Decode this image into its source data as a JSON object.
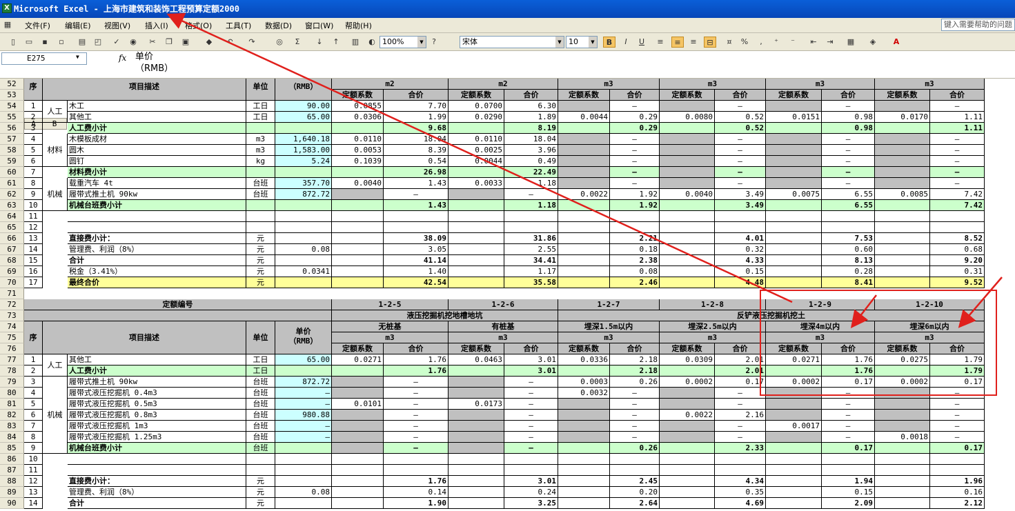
{
  "window": {
    "title": "Microsoft Excel - 上海市建筑和装饰工程预算定额2000"
  },
  "menu": [
    "文件(F)",
    "编辑(E)",
    "视图(V)",
    "插入(I)",
    "格式(O)",
    "工具(T)",
    "数据(D)",
    "窗口(W)",
    "帮助(H)"
  ],
  "help_box": "键入需要帮助的问题",
  "toolbar": {
    "zoom": "100%",
    "font": "宋体",
    "size": "10"
  },
  "formula": {
    "cell_ref": "E275",
    "fx": "fx",
    "content": "单价\n（RMB）"
  },
  "col_headers": [
    "A",
    "B"
  ],
  "table1": {
    "header_rows": [
      {
        "row": "52",
        "cells": [
          "序",
          "项目描述",
          "单位",
          "（RMB）",
          "m2",
          "",
          "m2",
          "",
          "m3",
          "",
          "m3",
          "",
          "m3",
          "",
          "m3",
          ""
        ]
      },
      {
        "row": "53",
        "cells": [
          "",
          "",
          "",
          "",
          "定额系数",
          "合价",
          "定额系数",
          "合价",
          "定额系数",
          "合价",
          "定额系数",
          "合价",
          "定额系数",
          "合价",
          "定额系数",
          "合价"
        ]
      }
    ],
    "rows": [
      {
        "row": "54",
        "cells": [
          "1",
          "人工",
          "木工",
          "工日",
          "90.00",
          "0.0855",
          "7.70",
          "0.0700",
          "6.30",
          "",
          "–",
          "",
          "–",
          "",
          "–",
          "",
          "–"
        ]
      },
      {
        "row": "55",
        "cells": [
          "2",
          "",
          "其他工",
          "工日",
          "65.00",
          "0.0306",
          "1.99",
          "0.0290",
          "1.89",
          "0.0044",
          "0.29",
          "0.0080",
          "0.52",
          "0.0151",
          "0.98",
          "0.0170",
          "1.11"
        ]
      },
      {
        "row": "56",
        "cells": [
          "3",
          "",
          "人工费小计",
          "",
          "",
          "",
          "9.68",
          "",
          "8.19",
          "",
          "0.29",
          "",
          "0.52",
          "",
          "0.98",
          "",
          "1.11"
        ]
      },
      {
        "row": "57",
        "cells": [
          "4",
          "材料",
          "木模板成材",
          "m3",
          "1,640.18",
          "0.0110",
          "18.04",
          "0.0110",
          "18.04",
          "",
          "–",
          "",
          "–",
          "",
          "–",
          "",
          "–"
        ]
      },
      {
        "row": "58",
        "cells": [
          "5",
          "",
          "圆木",
          "m3",
          "1,583.00",
          "0.0053",
          "8.39",
          "0.0025",
          "3.96",
          "",
          "–",
          "",
          "–",
          "",
          "–",
          "",
          "–"
        ]
      },
      {
        "row": "59",
        "cells": [
          "6",
          "",
          "圆钉",
          "kg",
          "5.24",
          "0.1039",
          "0.54",
          "0.0044",
          "0.49",
          "",
          "–",
          "",
          "–",
          "",
          "–",
          "",
          "–"
        ]
      },
      {
        "row": "60",
        "cells": [
          "7",
          "",
          "材料费小计",
          "",
          "",
          "",
          "26.98",
          "",
          "22.49",
          "",
          "–",
          "",
          "–",
          "",
          "–",
          "",
          "–"
        ]
      },
      {
        "row": "61",
        "cells": [
          "8",
          "机械",
          "载重汽车  4t",
          "台班",
          "357.70",
          "0.0040",
          "1.43",
          "0.0033",
          "1.18",
          "",
          "–",
          "",
          "–",
          "",
          "–",
          "",
          "–"
        ]
      },
      {
        "row": "62",
        "cells": [
          "9",
          "",
          "履带式推土机 90kw",
          "台班",
          "872.72",
          "",
          "–",
          "",
          "–",
          "0.0022",
          "1.92",
          "0.0040",
          "3.49",
          "0.0075",
          "6.55",
          "0.0085",
          "7.42"
        ]
      },
      {
        "row": "63",
        "cells": [
          "10",
          "",
          "机械台班费小计",
          "",
          "",
          "",
          "1.43",
          "",
          "1.18",
          "",
          "1.92",
          "",
          "3.49",
          "",
          "6.55",
          "",
          "7.42"
        ]
      },
      {
        "row": "64",
        "cells": [
          "11",
          "",
          "",
          "",
          "",
          "",
          "",
          "",
          "",
          "",
          "",
          "",
          "",
          "",
          "",
          "",
          ""
        ]
      },
      {
        "row": "65",
        "cells": [
          "12",
          "",
          "",
          "",
          "",
          "",
          "",
          "",
          "",
          "",
          "",
          "",
          "",
          "",
          "",
          "",
          ""
        ]
      },
      {
        "row": "66",
        "cells": [
          "13",
          "",
          "直接费小计：",
          "元",
          "",
          "",
          "38.09",
          "",
          "31.86",
          "",
          "2.21",
          "",
          "4.01",
          "",
          "7.53",
          "",
          "8.52"
        ]
      },
      {
        "row": "67",
        "cells": [
          "14",
          "",
          "管理费、利润（8%）",
          "元",
          "0.08",
          "",
          "3.05",
          "",
          "2.55",
          "",
          "0.18",
          "",
          "0.32",
          "",
          "0.60",
          "",
          "0.68"
        ]
      },
      {
        "row": "68",
        "cells": [
          "15",
          "",
          "合计",
          "元",
          "",
          "",
          "41.14",
          "",
          "34.41",
          "",
          "2.38",
          "",
          "4.33",
          "",
          "8.13",
          "",
          "9.20"
        ]
      },
      {
        "row": "69",
        "cells": [
          "16",
          "",
          "税金（3.41%）",
          "元",
          "0.0341",
          "",
          "1.40",
          "",
          "1.17",
          "",
          "0.08",
          "",
          "0.15",
          "",
          "0.28",
          "",
          "0.31"
        ]
      },
      {
        "row": "70",
        "cells": [
          "17",
          "",
          "最终合价",
          "元",
          "",
          "",
          "42.54",
          "",
          "35.58",
          "",
          "2.46",
          "",
          "4.48",
          "",
          "8.41",
          "",
          "9.52"
        ]
      }
    ]
  },
  "table2": {
    "header_rows": [
      {
        "row": "72",
        "cells": [
          "定额编号",
          "1-2-5",
          "1-2-6",
          "1-2-7",
          "1-2-8",
          "1-2-9",
          "1-2-10"
        ]
      },
      {
        "row": "73",
        "cells": [
          "液压挖掘机挖地槽地坑",
          "反铲液压挖掘机挖土"
        ]
      },
      {
        "row": "74",
        "cells": [
          "序",
          "项目描述",
          "单位",
          "单价",
          "无桩基",
          "有桩基",
          "埋深1.5m以内",
          "埋深2.5m以内",
          "埋深4m以内",
          "埋深6m以内"
        ]
      },
      {
        "row": "75",
        "cells": [
          "（RMB）",
          "m3",
          "m3",
          "m3",
          "m3",
          "m3",
          "m3"
        ]
      },
      {
        "row": "76",
        "cells": [
          "定额系数",
          "合价",
          "定额系数",
          "合价",
          "定额系数",
          "合价",
          "定额系数",
          "合价",
          "定额系数",
          "合价",
          "定额系数",
          "合价"
        ]
      }
    ],
    "rows": [
      {
        "row": "77",
        "cells": [
          "1",
          "人工",
          "其他工",
          "工日",
          "65.00",
          "0.0271",
          "1.76",
          "0.0463",
          "3.01",
          "0.0336",
          "2.18",
          "0.0309",
          "2.01",
          "0.0271",
          "1.76",
          "0.0275",
          "1.79"
        ]
      },
      {
        "row": "78",
        "cells": [
          "2",
          "",
          "人工费小计",
          "工日",
          "",
          "",
          "1.76",
          "",
          "3.01",
          "",
          "2.18",
          "",
          "2.01",
          "",
          "1.76",
          "",
          "1.79"
        ]
      },
      {
        "row": "79",
        "cells": [
          "3",
          "机械",
          "履带式推土机 90kw",
          "台班",
          "872.72",
          "",
          "–",
          "",
          "–",
          "0.0003",
          "0.26",
          "0.0002",
          "0.17",
          "0.0002",
          "0.17",
          "0.0002",
          "0.17"
        ]
      },
      {
        "row": "80",
        "cells": [
          "4",
          "",
          "履带式液压挖掘机 0.4m3",
          "台班",
          "–",
          "",
          "–",
          "",
          "–",
          "0.0032",
          "–",
          "",
          "–",
          "",
          "–",
          "",
          "–"
        ]
      },
      {
        "row": "81",
        "cells": [
          "5",
          "",
          "履带式液压挖掘机 0.5m3",
          "台班",
          "–",
          "0.0101",
          "–",
          "0.0173",
          "–",
          "",
          "–",
          "",
          "–",
          "",
          "–",
          "",
          "–"
        ]
      },
      {
        "row": "82",
        "cells": [
          "6",
          "",
          "履带式液压挖掘机 0.8m3",
          "台班",
          "980.88",
          "",
          "–",
          "",
          "–",
          "",
          "–",
          "0.0022",
          "2.16",
          "",
          "–",
          "",
          "–"
        ]
      },
      {
        "row": "83",
        "cells": [
          "7",
          "",
          "履带式液压挖掘机 1m3",
          "台班",
          "–",
          "",
          "–",
          "",
          "–",
          "",
          "–",
          "",
          "–",
          "0.0017",
          "–",
          "",
          "–"
        ]
      },
      {
        "row": "84",
        "cells": [
          "8",
          "",
          "履带式液压挖掘机 1.25m3",
          "台班",
          "–",
          "",
          "–",
          "",
          "–",
          "",
          "–",
          "",
          "–",
          "",
          "–",
          "0.0018",
          "–"
        ]
      },
      {
        "row": "85",
        "cells": [
          "9",
          "",
          "机械台班费小计",
          "台班",
          "",
          "",
          "–",
          "",
          "–",
          "",
          "0.26",
          "",
          "2.33",
          "",
          "0.17",
          "",
          "0.17"
        ]
      },
      {
        "row": "86",
        "cells": [
          "10",
          "",
          "",
          "",
          "",
          "",
          "",
          "",
          "",
          "",
          "",
          "",
          "",
          "",
          "",
          "",
          ""
        ]
      },
      {
        "row": "87",
        "cells": [
          "11",
          "",
          "",
          "",
          "",
          "",
          "",
          "",
          "",
          "",
          "",
          "",
          "",
          "",
          "",
          "",
          ""
        ]
      },
      {
        "row": "88",
        "cells": [
          "12",
          "",
          "直接费小计：",
          "元",
          "",
          "",
          "1.76",
          "",
          "3.01",
          "",
          "2.45",
          "",
          "4.34",
          "",
          "1.94",
          "",
          "1.96"
        ]
      },
      {
        "row": "89",
        "cells": [
          "13",
          "",
          "管理费、利润（8%）",
          "元",
          "0.08",
          "",
          "0.14",
          "",
          "0.24",
          "",
          "0.20",
          "",
          "0.35",
          "",
          "0.15",
          "",
          "0.16"
        ]
      },
      {
        "row": "90",
        "cells": [
          "14",
          "",
          "合计",
          "元",
          "",
          "",
          "1.90",
          "",
          "3.25",
          "",
          "2.64",
          "",
          "4.69",
          "",
          "2.09",
          "",
          "2.12"
        ]
      }
    ]
  },
  "empty_row": "71",
  "annotation_color": "#e0201c"
}
